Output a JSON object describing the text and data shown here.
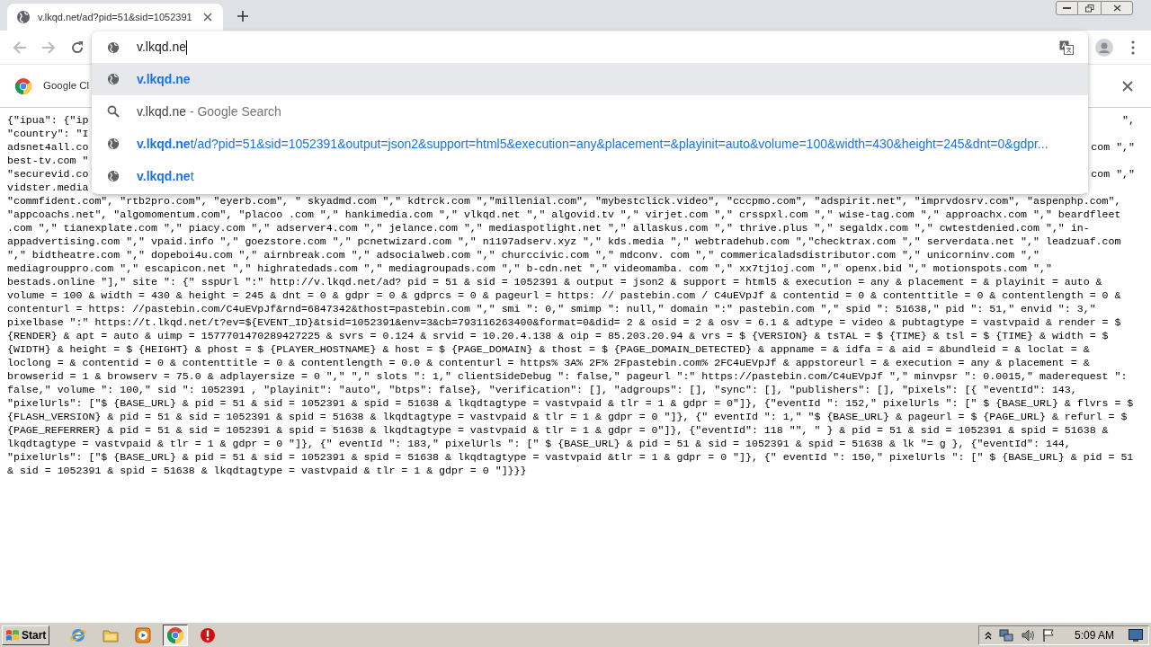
{
  "tab": {
    "title": "v.lkqd.net/ad?pid=51&sid=1052391"
  },
  "omnibox": {
    "value": "v.lkqd.ne"
  },
  "suggestions": [
    {
      "kind": "exact",
      "text": "v.lkqd.ne",
      "selected": true
    },
    {
      "kind": "search",
      "query": "v.lkqd.ne",
      "suffix": " - Google Search",
      "selected": false
    },
    {
      "kind": "url",
      "text": "**v.lkqd.ne**t/ad?pid=51&sid=1052391&output=json2&support=html5&execution=any&placement=&playinit=auto&volume=100&width=430&height=245&dnt=0&gdpr...",
      "selected": false
    },
    {
      "kind": "url",
      "text": "**v.lkqd.ne**t",
      "selected": false
    }
  ],
  "infobar": {
    "text": "Google Cl"
  },
  "page": {
    "covered_lines": [
      {
        "left": "{\"ipua\": {\"ip",
        "right": "\","
      },
      {
        "left": "\"country\": \"I"
      },
      {
        "left": "adsnet4all.co",
        "right": "com \",\""
      },
      {
        "left": "best-tv.com \""
      },
      {
        "left": "\"securevid.co",
        "right": "com \",\""
      },
      {
        "left": "vidster.media"
      }
    ],
    "lines": [
      "\"commfident.com\", \"rtb2pro.com\", \"eyerb.com\", \" skyadmd.com \",\" kdtrck.com \",\"millenial.com\", \"mybestclick.video\", \"cccpmo.com\", \"adspirit.net\", \"imprvdosrv.com\", \"aspenphp.com\",",
      "\"appcoachs.net\", \"algomomentum.com\", \"placoo .com \",\" hankimedia.com \",\" vlkqd.net \",\" algovid.tv \",\" virjet.com \",\" crsspxl.com \",\" wise-tag.com \",\" approachx.com \",\" beardfleet",
      ".com \",\" tianexplate.com \",\" piacy.com \",\" adserver4.com \",\" jelance.com \",\" mediaspotlight.net \",\" allaskus.com \",\" thrive.plus \",\" segaldx.com \",\" cwtestdenied.com \",\" in-",
      "appadvertising.com \",\" vpaid.info \",\" goezstore.com \",\" pcnetwizard.com \",\" n1197adserv.xyz \",\" kds.media \",\" webtradehub.com \",\"checktrax.com \",\" serverdata.net \",\" leadzuaf.com",
      "\",\" bidtheatre.com \",\" dopeboi4u.com \",\" airnbreak.com \",\" adsocialweb.com \",\" churccivic.com \",\" mdconv. com \",\" commericaladsdistributor.com \",\" unicorninv.com \",\"",
      "mediagrouppro.com \",\" escapicon.net \",\" highratedads.com \",\" mediagroupads.com \",\" b-cdn.net \",\" videomamba. com \",\" xx7tj1oj.com \",\" openx.bid \",\" motionspots.com \",\"",
      "bestads.online \"],\" site \": {\" sspUrl \":\" http://v.lkqd.net/ad? pid = 51 & sid = 1052391 & output = json2 & support = html5 & execution = any & placement = & playinit = auto &",
      "volume = 100 & width = 430 & height = 245 & dnt = 0 & gdpr = 0 & gdprcs = 0 & pageurl = https: // pastebin.com / C4uEVpJf & contentid = 0 & contenttitle = 0 & contentlength = 0 &",
      "contenturl = https: //pastebin.com/C4uEVpJf&rnd=6847342&thost=pastebin.com \",\" smi \": 0,\" smimp \": null,\" domain \":\" pastebin.com \",\" spid \": 51638,\" pid \": 51,\" envid \": 3,\"",
      "pixelbase \":\" https://t.lkqd.net/t?ev=${EVENT_ID}&tsid=1052391&env=3&cb=793116263400&format=0&did= 2 & osid = 2 & osv = 6.1 & adtype = video & pubtagtype = vastvpaid & render = $",
      "{RENDER} & apt = auto & uimp = 1577701470289427225 & svrs = 0.124 & srvid = 10.20.4.138 & oip = 85.203.20.94 & vrs = $ {VERSION} & tsTAL = $ {TIME} & tsl = $ {TIME} & width = $",
      "{WIDTH} & height = $ {HEIGHT} & phost = $ {PLAYER_HOSTNAME} & host = $ {PAGE_DOMAIN} & thost = $ {PAGE_DOMAIN_DETECTED} & appname = & idfa = & aid = &bundleid = & loclat = &",
      "loclong = & contentid = 0 & contenttitle = 0 & contentlength = 0.0 & contenturl = https% 3A% 2F% 2Fpastebin.com% 2FC4uEVpJf & appstoreurl = & execution = any & placement = &",
      "browserid = 1 & browserv = 75.0 & adplayersize = 0 \",\" \",\" slots \": 1,\" clientSideDebug \": false,\" pageurl \":\" https://pastebin.com/C4uEVpJf \",\" minvpsr \": 0.0015,\" maderequest \":",
      "false,\" volume \": 100,\" sid \": 1052391 , \"playinit\": \"auto\", \"btps\": false}, \"verification\": [], \"adgroups\": [], \"sync\": [], \"publishers\": [], \"pixels\": [{ \"eventId\": 143,",
      "\"pixelUrls\": [\"$ {BASE_URL} & pid = 51 & sid = 1052391 & spid = 51638 & lkqdtagtype = vastvpaid & tlr = 1 & gdpr = 0\"]}, {\"eventId \": 152,\" pixelUrls \": [\" $ {BASE_URL} & flvrs = $",
      "{FLASH_VERSION} & pid = 51 & sid = 1052391 & spid = 51638 & lkqdtagtype = vastvpaid & tlr = 1 & gdpr = 0 \"]}, {\" eventId \": 1,\" \"$ {BASE_URL} & pageurl = $ {PAGE_URL} & refurl = $",
      "{PAGE_REFERRER} & pid = 51 & sid = 1052391 & spid = 51638 & lkqdtagtype = vastvpaid & tlr = 1 & gdpr = 0\"]}, {\"eventId\": 118 \"\", \" } & pid = 51 & sid = 1052391 & spid = 51638 &",
      "lkqdtagtype = vastvpaid & tlr = 1 & gdpr = 0 \"]}, {\" eventId \": 183,\" pixelUrls \": [\" $ {BASE_URL} & pid = 51 & sid = 1052391 & spid = 51638 & lk \"= g }, {\"eventId\": 144,",
      "\"pixelUrls\": [\"$ {BASE_URL} & pid = 51 & sid = 1052391 & spid = 51638 & lkqdtagtype = vastvpaid &tlr = 1 & gdpr = 0 \"]}, {\" eventId \": 150,\" pixelUrls \": [\" $ {BASE_URL} & pid = 51",
      "& sid = 1052391 & spid = 51638 & lkqdtagtype = vastvpaid & tlr = 1 & gdpr = 0 \"]}}}"
    ]
  },
  "taskbar": {
    "start": "Start",
    "apps": [
      {
        "kind": "ie",
        "selected": false
      },
      {
        "kind": "folder",
        "selected": false
      },
      {
        "kind": "media",
        "selected": false
      },
      {
        "kind": "chrome",
        "selected": true
      },
      {
        "kind": "stop",
        "selected": false
      }
    ],
    "clock": "5:09 AM"
  }
}
